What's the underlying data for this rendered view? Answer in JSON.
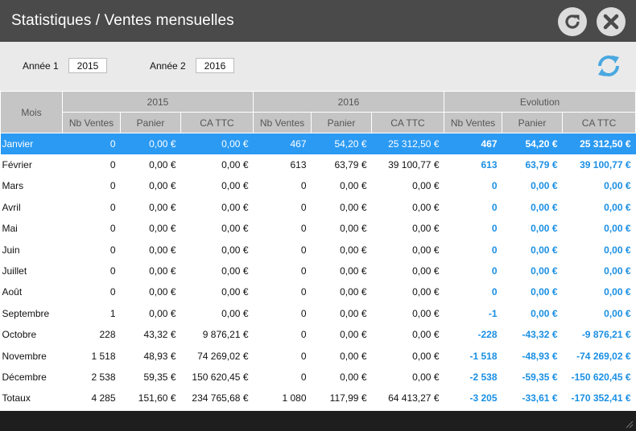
{
  "window": {
    "title": "Statistiques / Ventes mensuelles"
  },
  "titlebar_buttons": [
    {
      "name": "refresh-button",
      "icon": "refresh-icon"
    },
    {
      "name": "close-button",
      "icon": "close-icon"
    }
  ],
  "filters": {
    "year1_label": "Année 1",
    "year1_value": "2015",
    "year2_label": "Année 2",
    "year2_value": "2016",
    "reload_icon": "sync-icon",
    "reload_color": "#4aa8e0"
  },
  "table": {
    "month_header": "Mois",
    "groups": [
      "2015",
      "2016",
      "Evolution"
    ],
    "subheaders": [
      "Nb Ventes",
      "Panier",
      "CA TTC",
      "Nb Ventes",
      "Panier",
      "CA TTC",
      "Nb Ventes",
      "Panier",
      "CA TTC"
    ],
    "selected_index": 0,
    "rows": [
      {
        "month": "Janvier",
        "cells": [
          "0",
          "0,00 €",
          "0,00 €",
          "467",
          "54,20 €",
          "25 312,50 €",
          "467",
          "54,20 €",
          "25 312,50 €"
        ]
      },
      {
        "month": "Février",
        "cells": [
          "0",
          "0,00 €",
          "0,00 €",
          "613",
          "63,79 €",
          "39 100,77 €",
          "613",
          "63,79 €",
          "39 100,77 €"
        ]
      },
      {
        "month": "Mars",
        "cells": [
          "0",
          "0,00 €",
          "0,00 €",
          "0",
          "0,00 €",
          "0,00 €",
          "0",
          "0,00 €",
          "0,00 €"
        ]
      },
      {
        "month": "Avril",
        "cells": [
          "0",
          "0,00 €",
          "0,00 €",
          "0",
          "0,00 €",
          "0,00 €",
          "0",
          "0,00 €",
          "0,00 €"
        ]
      },
      {
        "month": "Mai",
        "cells": [
          "0",
          "0,00 €",
          "0,00 €",
          "0",
          "0,00 €",
          "0,00 €",
          "0",
          "0,00 €",
          "0,00 €"
        ]
      },
      {
        "month": "Juin",
        "cells": [
          "0",
          "0,00 €",
          "0,00 €",
          "0",
          "0,00 €",
          "0,00 €",
          "0",
          "0,00 €",
          "0,00 €"
        ]
      },
      {
        "month": "Juillet",
        "cells": [
          "0",
          "0,00 €",
          "0,00 €",
          "0",
          "0,00 €",
          "0,00 €",
          "0",
          "0,00 €",
          "0,00 €"
        ]
      },
      {
        "month": "Août",
        "cells": [
          "0",
          "0,00 €",
          "0,00 €",
          "0",
          "0,00 €",
          "0,00 €",
          "0",
          "0,00 €",
          "0,00 €"
        ]
      },
      {
        "month": "Septembre",
        "cells": [
          "1",
          "0,00 €",
          "0,00 €",
          "0",
          "0,00 €",
          "0,00 €",
          "-1",
          "0,00 €",
          "0,00 €"
        ]
      },
      {
        "month": "Octobre",
        "cells": [
          "228",
          "43,32 €",
          "9 876,21 €",
          "0",
          "0,00 €",
          "0,00 €",
          "-228",
          "-43,32 €",
          "-9 876,21 €"
        ]
      },
      {
        "month": "Novembre",
        "cells": [
          "1 518",
          "48,93 €",
          "74 269,02 €",
          "0",
          "0,00 €",
          "0,00 €",
          "-1 518",
          "-48,93 €",
          "-74 269,02 €"
        ]
      },
      {
        "month": "Décembre",
        "cells": [
          "2 538",
          "59,35 €",
          "150 620,45 €",
          "0",
          "0,00 €",
          "0,00 €",
          "-2 538",
          "-59,35 €",
          "-150 620,45 €"
        ]
      },
      {
        "month": "Totaux",
        "cells": [
          "4 285",
          "151,60 €",
          "234 765,68 €",
          "1 080",
          "117,99 €",
          "64 413,27 €",
          "-3 205",
          "-33,61 €",
          "-170 352,41 €"
        ]
      }
    ]
  },
  "colors": {
    "titlebar": "#4a4a4a",
    "selected_row": "#2b9af3",
    "evolution_text": "#1a8fe3",
    "header_bg": "#c5c5c5"
  }
}
